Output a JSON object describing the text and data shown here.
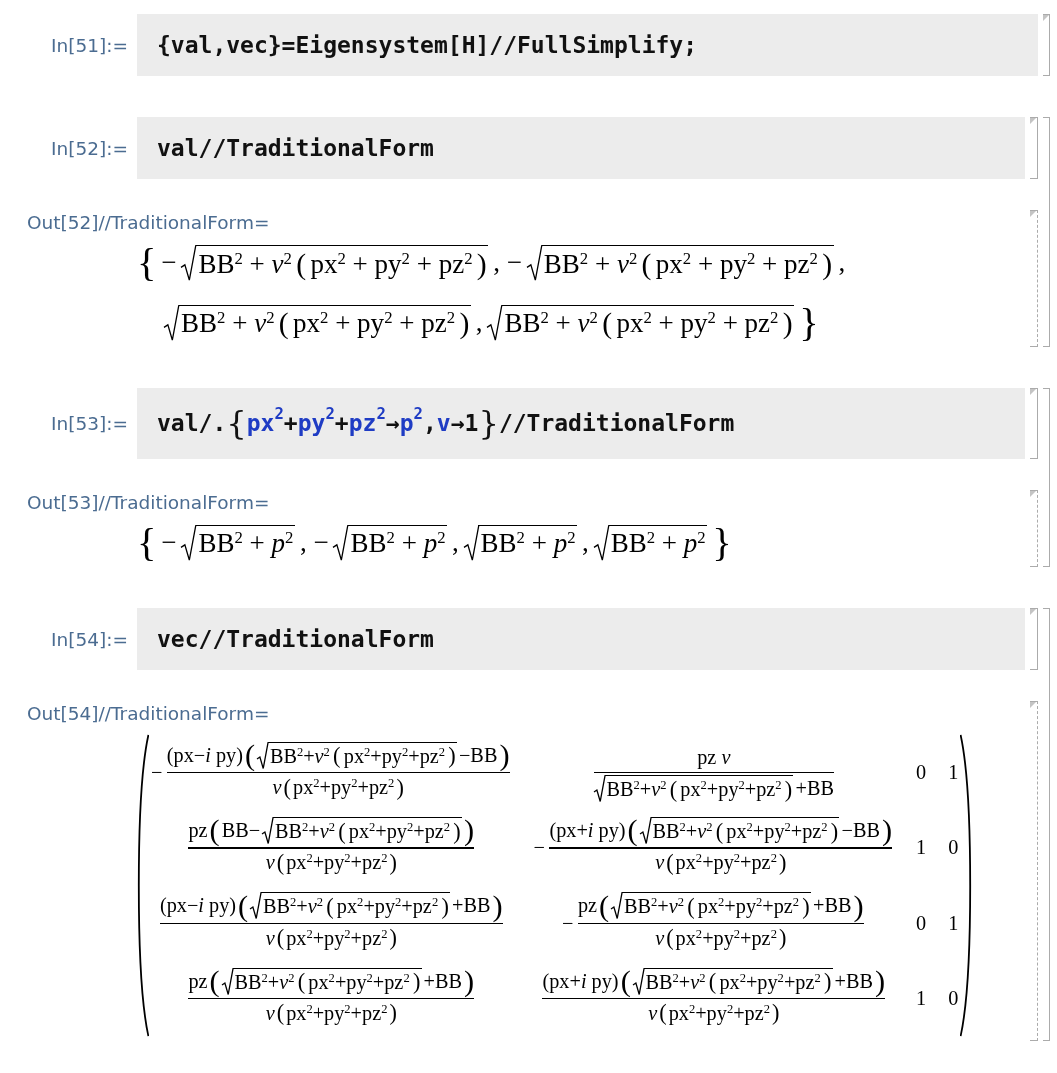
{
  "cells": [
    {
      "input": {
        "label": "In[51]:=",
        "tokens": [
          {
            "kind": "code",
            "text": "{val,vec}=Eigensystem[H]//FullSimplify;"
          }
        ]
      }
    },
    {
      "input": {
        "label": "In[52]:=",
        "tokens": [
          {
            "kind": "code",
            "text": "val//TraditionalForm"
          }
        ]
      },
      "output": {
        "label": "Out[52]//TraditionalForm=",
        "lines": [
          [
            {
              "kind": "tall-delim",
              "text": "{"
            },
            {
              "kind": "text",
              "text": "−"
            },
            {
              "kind": "sqrt",
              "body": [
                {
                  "kind": "text",
                  "text": "BB$^{2}$ + *v*$^{2}$"
                },
                {
                  "kind": "delim",
                  "text": "("
                },
                {
                  "kind": "text",
                  "text": "px$^{2}$ + py$^{2}$ + pz$^{2}$"
                },
                {
                  "kind": "delim",
                  "text": ")"
                }
              ]
            },
            {
              "kind": "text",
              "text": ", −"
            },
            {
              "kind": "sqrt",
              "body": [
                {
                  "kind": "text",
                  "text": "BB$^{2}$ + *v*$^{2}$"
                },
                {
                  "kind": "delim",
                  "text": "("
                },
                {
                  "kind": "text",
                  "text": "px$^{2}$ + py$^{2}$ + pz$^{2}$"
                },
                {
                  "kind": "delim",
                  "text": ")"
                }
              ]
            },
            {
              "kind": "text",
              "text": ","
            }
          ],
          [
            {
              "kind": "sqrt",
              "body": [
                {
                  "kind": "text",
                  "text": "BB$^{2}$ + *v*$^{2}$"
                },
                {
                  "kind": "delim",
                  "text": "("
                },
                {
                  "kind": "text",
                  "text": "px$^{2}$ + py$^{2}$ + pz$^{2}$"
                },
                {
                  "kind": "delim",
                  "text": ")"
                }
              ]
            },
            {
              "kind": "text",
              "text": ","
            },
            {
              "kind": "sqrt",
              "body": [
                {
                  "kind": "text",
                  "text": "BB$^{2}$ + *v*$^{2}$"
                },
                {
                  "kind": "delim",
                  "text": "("
                },
                {
                  "kind": "text",
                  "text": "px$^{2}$ + py$^{2}$ + pz$^{2}$"
                },
                {
                  "kind": "delim",
                  "text": ")"
                }
              ]
            },
            {
              "kind": "tall-delim",
              "text": "}"
            }
          ]
        ]
      }
    },
    {
      "input": {
        "label": "In[53]:=",
        "tokens": [
          {
            "kind": "code",
            "text": "val/."
          },
          {
            "kind": "brace",
            "text": "{"
          },
          {
            "kind": "symbol",
            "text": "px$^{2}$"
          },
          {
            "kind": "code",
            "text": "+"
          },
          {
            "kind": "symbol",
            "text": "py$^{2}$"
          },
          {
            "kind": "code",
            "text": "+"
          },
          {
            "kind": "symbol",
            "text": "pz$^{2}$"
          },
          {
            "kind": "code",
            "text": "→"
          },
          {
            "kind": "symbol",
            "text": "p$^{2}$"
          },
          {
            "kind": "code",
            "text": ","
          },
          {
            "kind": "symbol",
            "text": "v"
          },
          {
            "kind": "code",
            "text": "→1"
          },
          {
            "kind": "brace",
            "text": "}"
          },
          {
            "kind": "code",
            "text": "//TraditionalForm"
          }
        ]
      },
      "output": {
        "label": "Out[53]//TraditionalForm=",
        "lines": [
          [
            {
              "kind": "tall-delim",
              "text": "{"
            },
            {
              "kind": "text",
              "text": "−"
            },
            {
              "kind": "sqrt",
              "body": [
                {
                  "kind": "text",
                  "text": "BB$^{2}$ + *p*$^{2}$"
                }
              ]
            },
            {
              "kind": "text",
              "text": ", −"
            },
            {
              "kind": "sqrt",
              "body": [
                {
                  "kind": "text",
                  "text": "BB$^{2}$ + *p*$^{2}$"
                }
              ]
            },
            {
              "kind": "text",
              "text": ","
            },
            {
              "kind": "sqrt",
              "body": [
                {
                  "kind": "text",
                  "text": "BB$^{2}$ + *p*$^{2}$"
                }
              ]
            },
            {
              "kind": "text",
              "text": ","
            },
            {
              "kind": "sqrt",
              "body": [
                {
                  "kind": "text",
                  "text": "BB$^{2}$ + *p*$^{2}$"
                }
              ]
            },
            {
              "kind": "tall-delim",
              "text": "}"
            }
          ]
        ]
      }
    },
    {
      "input": {
        "label": "In[54]:=",
        "tokens": [
          {
            "kind": "code",
            "text": "vec//TraditionalForm"
          }
        ]
      },
      "output": {
        "label": "Out[54]//TraditionalForm=",
        "lines": [
          [
            {
              "kind": "matrix",
              "rows": [
                [
                  [
                    {
                      "kind": "text",
                      "text": "−"
                    },
                    {
                      "kind": "frac",
                      "num": [
                        {
                          "kind": "text",
                          "text": "(px−*i* py)"
                        },
                        {
                          "kind": "tall-delim",
                          "text": "("
                        },
                        {
                          "kind": "sqrt",
                          "body": [
                            {
                              "kind": "text",
                              "text": "BB$^{2}$+*v*$^{2}$"
                            },
                            {
                              "kind": "delim",
                              "text": "("
                            },
                            {
                              "kind": "text",
                              "text": "px$^{2}$+py$^{2}$+pz$^{2}$"
                            },
                            {
                              "kind": "delim",
                              "text": ")"
                            }
                          ]
                        },
                        {
                          "kind": "text",
                          "text": "−BB"
                        },
                        {
                          "kind": "tall-delim",
                          "text": ")"
                        }
                      ],
                      "den": [
                        {
                          "kind": "text",
                          "text": "*v*"
                        },
                        {
                          "kind": "delim",
                          "text": "("
                        },
                        {
                          "kind": "text",
                          "text": "px$^{2}$+py$^{2}$+pz$^{2}$"
                        },
                        {
                          "kind": "delim",
                          "text": ")"
                        }
                      ]
                    }
                  ],
                  [
                    {
                      "kind": "frac",
                      "num": [
                        {
                          "kind": "text",
                          "text": "pz *v*"
                        }
                      ],
                      "den": [
                        {
                          "kind": "sqrt",
                          "body": [
                            {
                              "kind": "text",
                              "text": "BB$^{2}$+*v*$^{2}$"
                            },
                            {
                              "kind": "delim",
                              "text": "("
                            },
                            {
                              "kind": "text",
                              "text": "px$^{2}$+py$^{2}$+pz$^{2}$"
                            },
                            {
                              "kind": "delim",
                              "text": ")"
                            }
                          ]
                        },
                        {
                          "kind": "text",
                          "text": "+BB"
                        }
                      ]
                    }
                  ],
                  [
                    {
                      "kind": "text",
                      "text": "0"
                    }
                  ],
                  [
                    {
                      "kind": "text",
                      "text": "1"
                    }
                  ]
                ],
                [
                  [
                    {
                      "kind": "frac",
                      "num": [
                        {
                          "kind": "text",
                          "text": "pz"
                        },
                        {
                          "kind": "tall-delim",
                          "text": "("
                        },
                        {
                          "kind": "text",
                          "text": "BB−"
                        },
                        {
                          "kind": "sqrt",
                          "body": [
                            {
                              "kind": "text",
                              "text": "BB$^{2}$+*v*$^{2}$"
                            },
                            {
                              "kind": "delim",
                              "text": "("
                            },
                            {
                              "kind": "text",
                              "text": "px$^{2}$+py$^{2}$+pz$^{2}$"
                            },
                            {
                              "kind": "delim",
                              "text": ")"
                            }
                          ]
                        },
                        {
                          "kind": "tall-delim",
                          "text": ")"
                        }
                      ],
                      "den": [
                        {
                          "kind": "text",
                          "text": "*v*"
                        },
                        {
                          "kind": "delim",
                          "text": "("
                        },
                        {
                          "kind": "text",
                          "text": "px$^{2}$+py$^{2}$+pz$^{2}$"
                        },
                        {
                          "kind": "delim",
                          "text": ")"
                        }
                      ]
                    }
                  ],
                  [
                    {
                      "kind": "text",
                      "text": "−"
                    },
                    {
                      "kind": "frac",
                      "num": [
                        {
                          "kind": "text",
                          "text": "(px+*i* py)"
                        },
                        {
                          "kind": "tall-delim",
                          "text": "("
                        },
                        {
                          "kind": "sqrt",
                          "body": [
                            {
                              "kind": "text",
                              "text": "BB$^{2}$+*v*$^{2}$"
                            },
                            {
                              "kind": "delim",
                              "text": "("
                            },
                            {
                              "kind": "text",
                              "text": "px$^{2}$+py$^{2}$+pz$^{2}$"
                            },
                            {
                              "kind": "delim",
                              "text": ")"
                            }
                          ]
                        },
                        {
                          "kind": "text",
                          "text": "−BB"
                        },
                        {
                          "kind": "tall-delim",
                          "text": ")"
                        }
                      ],
                      "den": [
                        {
                          "kind": "text",
                          "text": "*v*"
                        },
                        {
                          "kind": "delim",
                          "text": "("
                        },
                        {
                          "kind": "text",
                          "text": "px$^{2}$+py$^{2}$+pz$^{2}$"
                        },
                        {
                          "kind": "delim",
                          "text": ")"
                        }
                      ]
                    }
                  ],
                  [
                    {
                      "kind": "text",
                      "text": "1"
                    }
                  ],
                  [
                    {
                      "kind": "text",
                      "text": "0"
                    }
                  ]
                ],
                [
                  [
                    {
                      "kind": "frac",
                      "num": [
                        {
                          "kind": "text",
                          "text": "(px−*i* py)"
                        },
                        {
                          "kind": "tall-delim",
                          "text": "("
                        },
                        {
                          "kind": "sqrt",
                          "body": [
                            {
                              "kind": "text",
                              "text": "BB$^{2}$+*v*$^{2}$"
                            },
                            {
                              "kind": "delim",
                              "text": "("
                            },
                            {
                              "kind": "text",
                              "text": "px$^{2}$+py$^{2}$+pz$^{2}$"
                            },
                            {
                              "kind": "delim",
                              "text": ")"
                            }
                          ]
                        },
                        {
                          "kind": "text",
                          "text": "+BB"
                        },
                        {
                          "kind": "tall-delim",
                          "text": ")"
                        }
                      ],
                      "den": [
                        {
                          "kind": "text",
                          "text": "*v*"
                        },
                        {
                          "kind": "delim",
                          "text": "("
                        },
                        {
                          "kind": "text",
                          "text": "px$^{2}$+py$^{2}$+pz$^{2}$"
                        },
                        {
                          "kind": "delim",
                          "text": ")"
                        }
                      ]
                    }
                  ],
                  [
                    {
                      "kind": "text",
                      "text": "−"
                    },
                    {
                      "kind": "frac",
                      "num": [
                        {
                          "kind": "text",
                          "text": "pz"
                        },
                        {
                          "kind": "tall-delim",
                          "text": "("
                        },
                        {
                          "kind": "sqrt",
                          "body": [
                            {
                              "kind": "text",
                              "text": "BB$^{2}$+*v*$^{2}$"
                            },
                            {
                              "kind": "delim",
                              "text": "("
                            },
                            {
                              "kind": "text",
                              "text": "px$^{2}$+py$^{2}$+pz$^{2}$"
                            },
                            {
                              "kind": "delim",
                              "text": ")"
                            }
                          ]
                        },
                        {
                          "kind": "text",
                          "text": "+BB"
                        },
                        {
                          "kind": "tall-delim",
                          "text": ")"
                        }
                      ],
                      "den": [
                        {
                          "kind": "text",
                          "text": "*v*"
                        },
                        {
                          "kind": "delim",
                          "text": "("
                        },
                        {
                          "kind": "text",
                          "text": "px$^{2}$+py$^{2}$+pz$^{2}$"
                        },
                        {
                          "kind": "delim",
                          "text": ")"
                        }
                      ]
                    }
                  ],
                  [
                    {
                      "kind": "text",
                      "text": "0"
                    }
                  ],
                  [
                    {
                      "kind": "text",
                      "text": "1"
                    }
                  ]
                ],
                [
                  [
                    {
                      "kind": "frac",
                      "num": [
                        {
                          "kind": "text",
                          "text": "pz"
                        },
                        {
                          "kind": "tall-delim",
                          "text": "("
                        },
                        {
                          "kind": "sqrt",
                          "body": [
                            {
                              "kind": "text",
                              "text": "BB$^{2}$+*v*$^{2}$"
                            },
                            {
                              "kind": "delim",
                              "text": "("
                            },
                            {
                              "kind": "text",
                              "text": "px$^{2}$+py$^{2}$+pz$^{2}$"
                            },
                            {
                              "kind": "delim",
                              "text": ")"
                            }
                          ]
                        },
                        {
                          "kind": "text",
                          "text": "+BB"
                        },
                        {
                          "kind": "tall-delim",
                          "text": ")"
                        }
                      ],
                      "den": [
                        {
                          "kind": "text",
                          "text": "*v*"
                        },
                        {
                          "kind": "delim",
                          "text": "("
                        },
                        {
                          "kind": "text",
                          "text": "px$^{2}$+py$^{2}$+pz$^{2}$"
                        },
                        {
                          "kind": "delim",
                          "text": ")"
                        }
                      ]
                    }
                  ],
                  [
                    {
                      "kind": "frac",
                      "num": [
                        {
                          "kind": "text",
                          "text": "(px+*i* py)"
                        },
                        {
                          "kind": "tall-delim",
                          "text": "("
                        },
                        {
                          "kind": "sqrt",
                          "body": [
                            {
                              "kind": "text",
                              "text": "BB$^{2}$+*v*$^{2}$"
                            },
                            {
                              "kind": "delim",
                              "text": "("
                            },
                            {
                              "kind": "text",
                              "text": "px$^{2}$+py$^{2}$+pz$^{2}$"
                            },
                            {
                              "kind": "delim",
                              "text": ")"
                            }
                          ]
                        },
                        {
                          "kind": "text",
                          "text": "+BB"
                        },
                        {
                          "kind": "tall-delim",
                          "text": ")"
                        }
                      ],
                      "den": [
                        {
                          "kind": "text",
                          "text": "*v*"
                        },
                        {
                          "kind": "delim",
                          "text": "("
                        },
                        {
                          "kind": "text",
                          "text": "px$^{2}$+py$^{2}$+pz$^{2}$"
                        },
                        {
                          "kind": "delim",
                          "text": ")"
                        }
                      ]
                    }
                  ],
                  [
                    {
                      "kind": "text",
                      "text": "1"
                    }
                  ],
                  [
                    {
                      "kind": "text",
                      "text": "0"
                    }
                  ]
                ]
              ]
            }
          ]
        ]
      }
    }
  ]
}
